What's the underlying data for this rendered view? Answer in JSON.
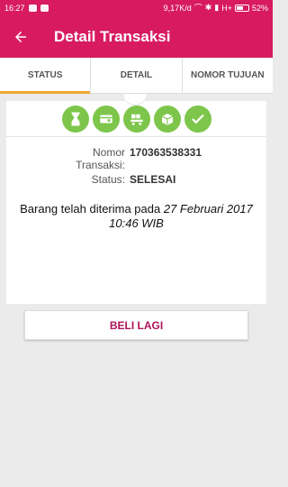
{
  "statusbar": {
    "time": "16:27",
    "network_speed": "9,17K/d",
    "signal": "H+",
    "battery": "52%"
  },
  "appbar": {
    "back_icon": "arrow-left-icon",
    "title": "Detail Transaksi"
  },
  "tabs": [
    {
      "label": "STATUS",
      "active": true
    },
    {
      "label": "DETAIL",
      "active": false
    },
    {
      "label": "NOMOR TUJUAN",
      "active": false
    }
  ],
  "progress_steps": [
    {
      "icon": "hourglass-icon"
    },
    {
      "icon": "payment-icon"
    },
    {
      "icon": "delivery-cart-icon"
    },
    {
      "icon": "package-icon"
    },
    {
      "icon": "checkmark-icon"
    }
  ],
  "transaction": {
    "number_label": "Nomor Transaksi:",
    "number_value": "170363538331",
    "status_label": "Status:",
    "status_value": "SELESAI"
  },
  "message": {
    "prefix": "Barang telah diterima pada ",
    "date": "27 Februari 2017 10:46 WIB"
  },
  "actions": {
    "buy_again_label": "BELI LAGI"
  },
  "colors": {
    "primary": "#d81b60",
    "accent": "#f0a830",
    "step_green": "#7dc64b"
  }
}
